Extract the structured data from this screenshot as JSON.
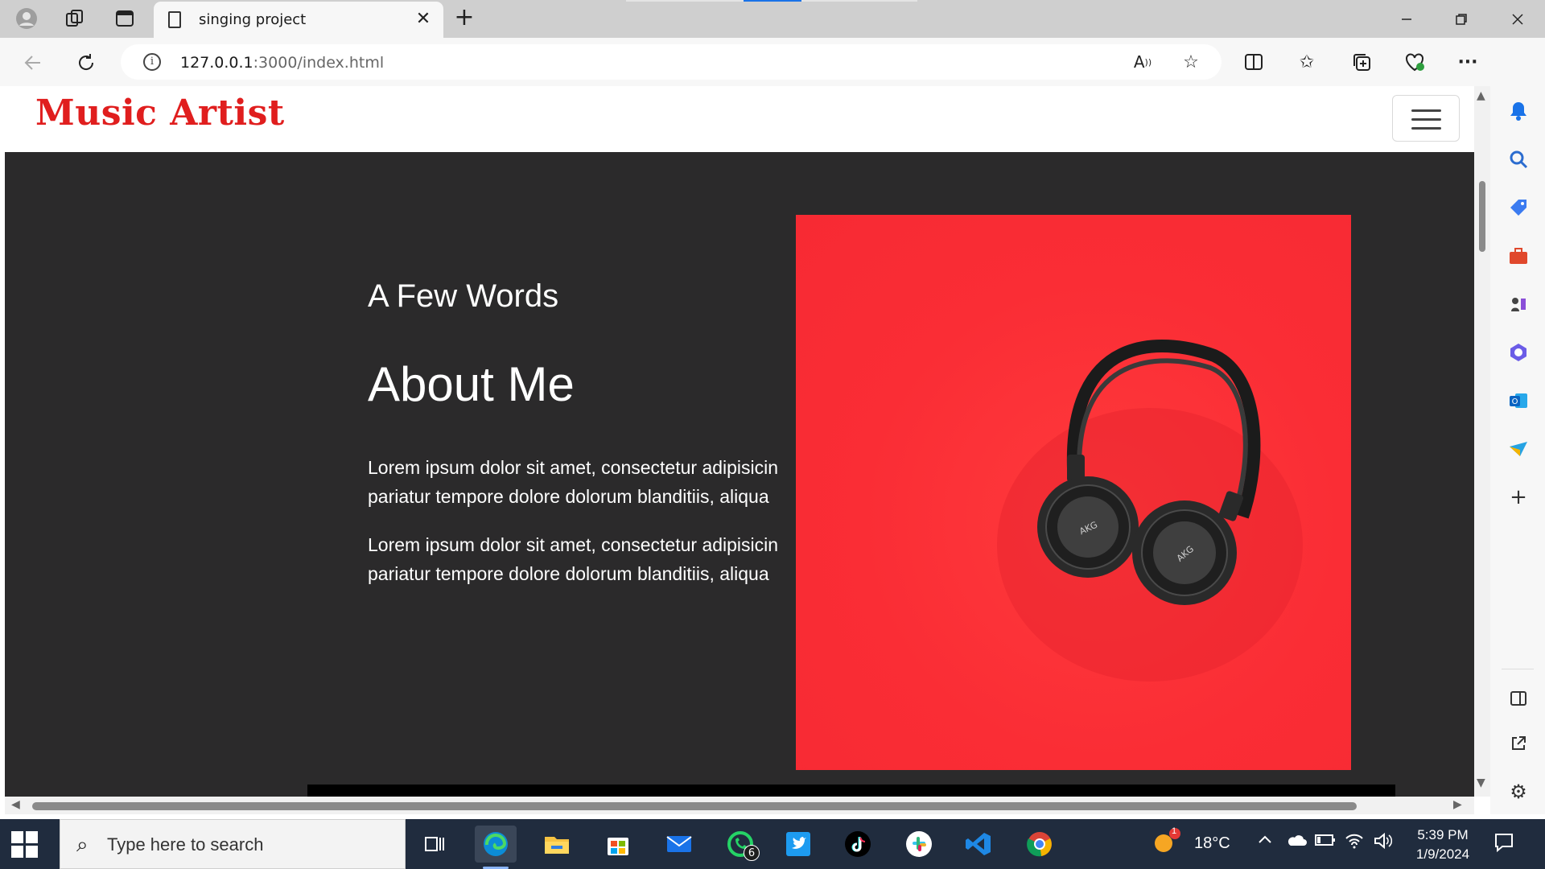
{
  "browser": {
    "tab_title": "singing project",
    "url_host": "127.0.0.1",
    "url_path": ":3000/index.html"
  },
  "site": {
    "brand": "Music Artist",
    "about": {
      "eyebrow": "A Few Words",
      "heading": "About Me",
      "paragraphs": [
        [
          "Lorem ipsum dolor sit amet, consectetur adipisicin",
          "pariatur tempore dolore dolorum blanditiis, aliqua"
        ],
        [
          "Lorem ipsum dolor sit amet, consectetur adipisicin",
          "pariatur tempore dolore dolorum blanditiis, aliqua"
        ]
      ],
      "image_text": "AKG",
      "image_bg_color": "#fa2d35"
    }
  },
  "taskbar": {
    "search_placeholder": "Type here to search",
    "whatsapp_badge": "6",
    "weather_badge": "1",
    "temperature": "18°C",
    "time": "5:39 PM",
    "date": "1/9/2024"
  }
}
